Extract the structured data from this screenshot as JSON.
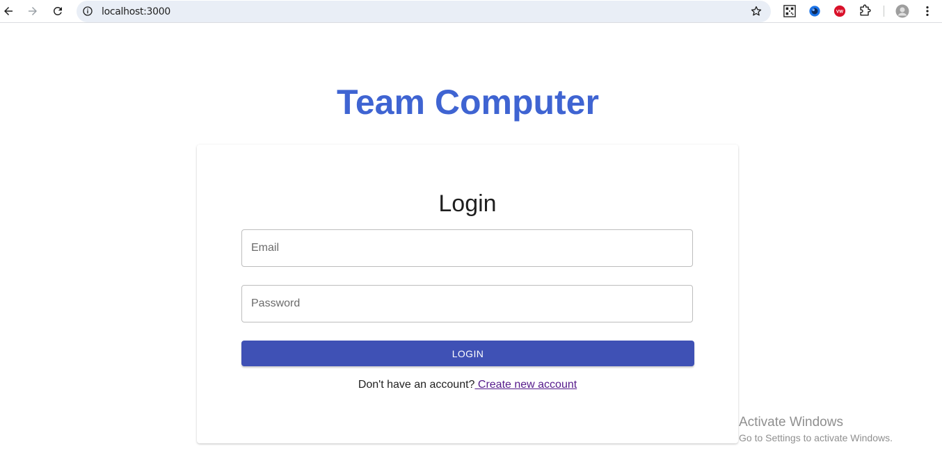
{
  "browser": {
    "url": "localhost:3000",
    "back_icon": "arrow-left-icon",
    "forward_icon": "arrow-right-icon",
    "reload_icon": "reload-icon",
    "info_icon": "info-icon",
    "bookmark_icon": "star-icon",
    "extensions": [
      "qr-code-icon",
      "edge-extension-icon",
      "vw-extension-icon",
      "puzzle-icon"
    ],
    "profile_icon": "avatar-icon",
    "menu_icon": "kebab-menu-icon"
  },
  "page": {
    "brand": "Team Computer",
    "brand_color": "#3f64d2",
    "login": {
      "title": "Login",
      "email_placeholder": "Email",
      "password_placeholder": "Password",
      "button_label": "LOGIN",
      "button_color": "#3f51b5",
      "signup_prompt": "Don't have an account?",
      "signup_link": " Create new account"
    }
  },
  "watermark": {
    "title": "Activate Windows",
    "subtitle": "Go to Settings to activate Windows."
  }
}
